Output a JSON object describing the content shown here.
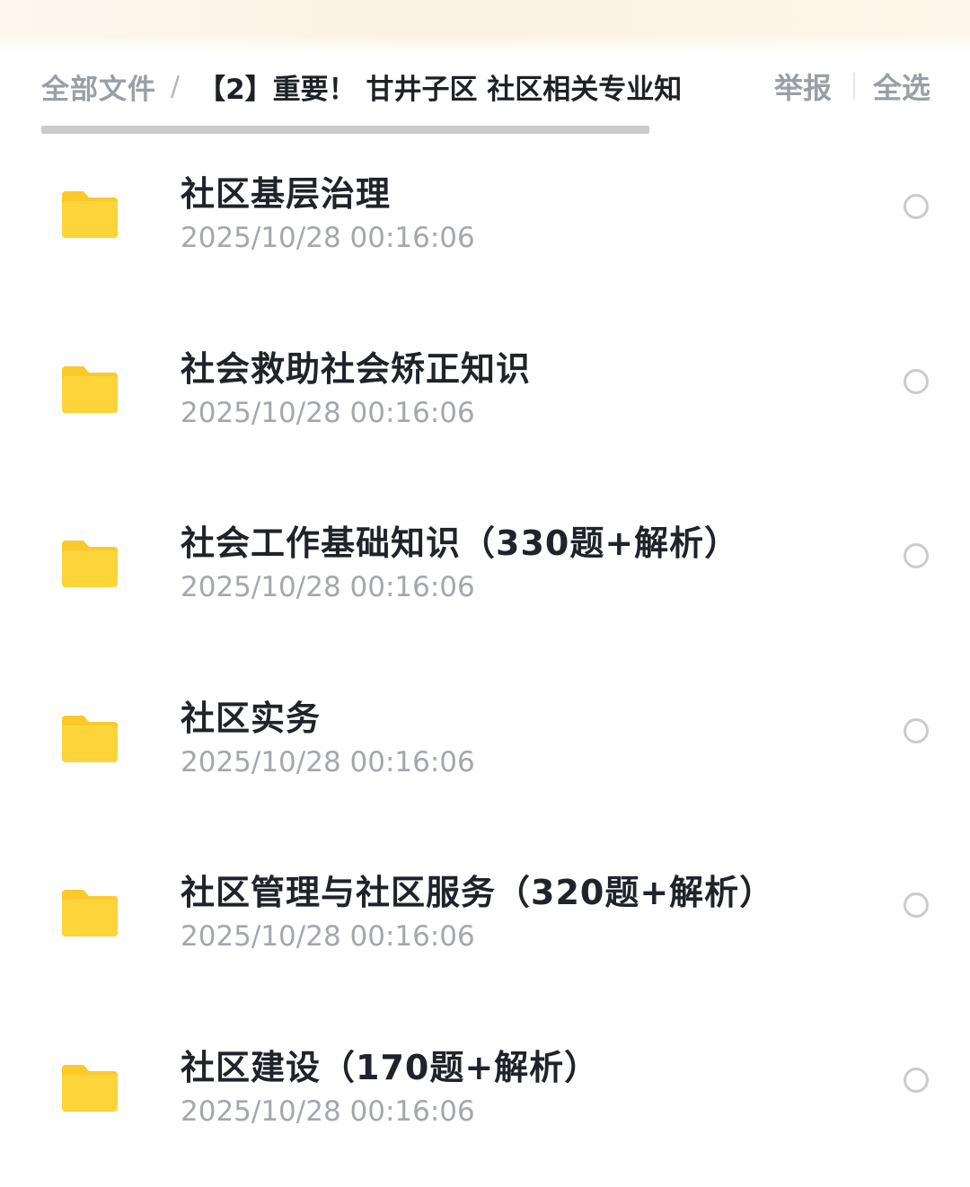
{
  "header": {
    "breadcrumb_root": "全部文件",
    "breadcrumb_separator": "/",
    "breadcrumb_current": "【2】重要！ 甘井子区 社区相关专业知",
    "report_label": "举报",
    "select_all_label": "全选"
  },
  "colors": {
    "folder": "#fdd53b",
    "folder_tab": "#fbc92a"
  },
  "files": [
    {
      "name": "社区基层治理",
      "time": "2025/10/28 00:16:06",
      "icon": "folder-icon"
    },
    {
      "name": "社会救助社会矫正知识",
      "time": "2025/10/28 00:16:06",
      "icon": "folder-icon"
    },
    {
      "name": "社会工作基础知识（330题+解析）",
      "time": "2025/10/28 00:16:06",
      "icon": "folder-icon"
    },
    {
      "name": "社区实务",
      "time": "2025/10/28 00:16:06",
      "icon": "folder-icon"
    },
    {
      "name": "社区管理与社区服务（320题+解析）",
      "time": "2025/10/28 00:16:06",
      "icon": "folder-icon"
    },
    {
      "name": "社区建设（170题+解析）",
      "time": "2025/10/28 00:16:06",
      "icon": "folder-icon"
    }
  ]
}
